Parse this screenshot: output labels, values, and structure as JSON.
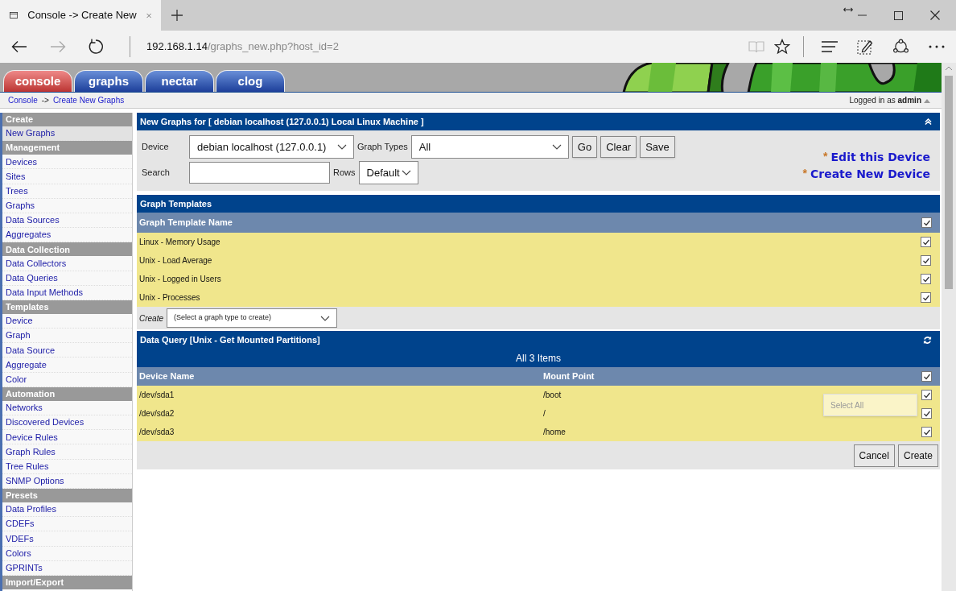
{
  "browser": {
    "tab_title": "Console -> Create New",
    "address_host": "192.168.1.14",
    "address_path": "/graphs_new.php?host_id=2"
  },
  "app_tabs": [
    {
      "label": "console",
      "selected": true
    },
    {
      "label": "graphs",
      "selected": false
    },
    {
      "label": "nectar",
      "selected": false
    },
    {
      "label": "clog",
      "selected": false
    }
  ],
  "header": {
    "kind": "picture"
  },
  "breadcrumb": [
    "Console",
    "Create New Graphs"
  ],
  "breadcrumb_separator": "->",
  "login": {
    "prefix": "Logged in as",
    "user": "admin"
  },
  "sidebar": [
    {
      "heading": "Create",
      "items": [
        {
          "label": "New Graphs",
          "selected": true
        }
      ]
    },
    {
      "heading": "Management",
      "items": [
        {
          "label": "Devices",
          "selected": false
        },
        {
          "label": "Sites",
          "selected": false
        },
        {
          "label": "Trees",
          "selected": false
        },
        {
          "label": "Graphs",
          "selected": false
        },
        {
          "label": "Data Sources",
          "selected": false
        },
        {
          "label": "Aggregates",
          "selected": false
        }
      ]
    },
    {
      "heading": "Data Collection",
      "items": [
        {
          "label": "Data Collectors",
          "selected": false
        },
        {
          "label": "Data Queries",
          "selected": false
        },
        {
          "label": "Data Input Methods",
          "selected": false
        }
      ]
    },
    {
      "heading": "Templates",
      "items": [
        {
          "label": "Device",
          "selected": false
        },
        {
          "label": "Graph",
          "selected": false
        },
        {
          "label": "Data Source",
          "selected": false
        },
        {
          "label": "Aggregate",
          "selected": false
        },
        {
          "label": "Color",
          "selected": false
        }
      ]
    },
    {
      "heading": "Automation",
      "items": [
        {
          "label": "Networks",
          "selected": false
        },
        {
          "label": "Discovered Devices",
          "selected": false
        },
        {
          "label": "Device Rules",
          "selected": false
        },
        {
          "label": "Graph Rules",
          "selected": false
        },
        {
          "label": "Tree Rules",
          "selected": false
        },
        {
          "label": "SNMP Options",
          "selected": false
        }
      ]
    },
    {
      "heading": "Presets",
      "items": [
        {
          "label": "Data Profiles",
          "selected": false
        },
        {
          "label": "CDEFs",
          "selected": false
        },
        {
          "label": "VDEFs",
          "selected": false
        },
        {
          "label": "Colors",
          "selected": false
        },
        {
          "label": "GPRINTs",
          "selected": false
        }
      ]
    },
    {
      "heading": "Import/Export"
    }
  ],
  "filter": {
    "title": "New Graphs for [ debian localhost (127.0.0.1) Local Linux Machine ]",
    "device_label": "Device",
    "device_value": "debian localhost (127.0.0.1)",
    "graph_types_label": "Graph Types",
    "graph_types_value": "All",
    "search_label": "Search",
    "rows_label": "Rows",
    "rows_value": "Default",
    "buttons": [
      "Go",
      "Clear",
      "Save"
    ],
    "links": [
      {
        "bullet": "*",
        "label": "Edit this Device"
      },
      {
        "bullet": "*",
        "label": "Create New Device"
      }
    ]
  },
  "graph_templates": {
    "title": "Graph Templates",
    "column": "Graph Template Name",
    "all_checked": true,
    "rows": [
      {
        "name": "Linux - Memory Usage",
        "checked": true
      },
      {
        "name": "Unix - Load Average",
        "checked": true
      },
      {
        "name": "Unix - Logged in Users",
        "checked": true
      },
      {
        "name": "Unix - Processes",
        "checked": true
      }
    ],
    "create_label": "Create",
    "create_value": "(Select a graph type to create)"
  },
  "data_query": {
    "title": "Data Query [Unix - Get Mounted Partitions]",
    "count": "All 3 Items",
    "columns": [
      "Device Name",
      "Mount Point"
    ],
    "all_checked": true,
    "rows": [
      {
        "cells": [
          "/dev/sda1",
          "/boot"
        ],
        "checked": true
      },
      {
        "cells": [
          "/dev/sda2",
          "/"
        ],
        "checked": true
      },
      {
        "cells": [
          "/dev/sda3",
          "/home"
        ],
        "checked": true
      }
    ],
    "tooltip": "Select All"
  },
  "actions": [
    "Cancel",
    "Create"
  ]
}
